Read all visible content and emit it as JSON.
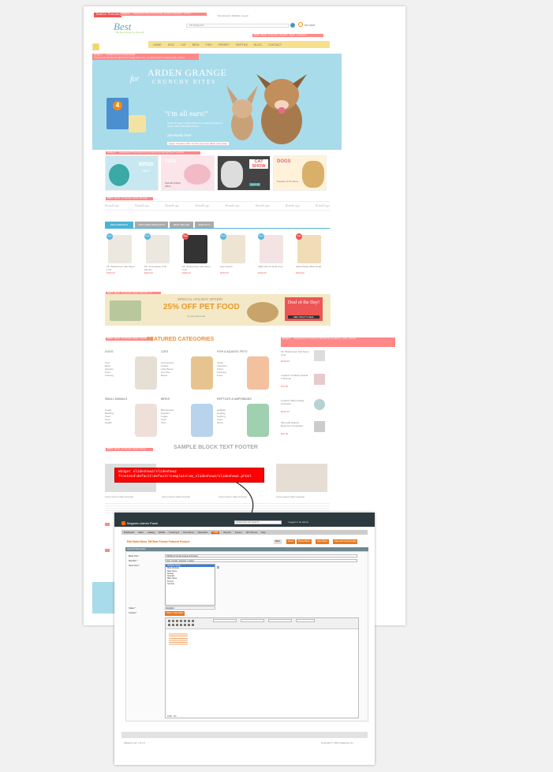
{
  "store": {
    "preview_label": "Enable Preview",
    "logo": "Best",
    "tagline": "The best choice on the web",
    "search_category": "All Categories",
    "cart_label": "MY CART",
    "nav": [
      "HOME",
      "DOG",
      "CAT",
      "BIRD",
      "FISH",
      "FERRET",
      "REPTILE",
      "BLOG",
      "CONTACT"
    ],
    "hints": {
      "top": "Widget: template/cms/frontend_blocks/header.phtml",
      "nav": "BEST Best Friends Header Menu Content",
      "slide": "Widget: slideshow2/slideshow2",
      "slide2": "frontend/default/default/template/sm_slideshow2/slideshow2.phtml",
      "tiles": "Widget: template/frontend/sm_blocks/grid/default.phtml",
      "brands": "BEST Best Friends Home Brand",
      "deal": "BEST Best Friends Home Banner 2",
      "featured": "BEST Best Friends Home Featured",
      "right": "Widget: template/frontend/default/product_list.phtml",
      "footer": "BEST Best Friends Home Blog"
    },
    "banner": {
      "brand_line1": "ARDEN GRANGE",
      "brand_line2": "CRUNCHY BITES",
      "script": "for",
      "quote": "\"i'm all ears!\"",
      "body": "Arden Grange Crunchy Bites are a delicious treat for dogs, made with fresh chicken",
      "cta": "absolutely free!",
      "badge": "4"
    },
    "tiles": [
      {
        "title": "BIRDS",
        "sub": "SALE"
      },
      {
        "title": "PIGS",
        "sub": "Special holiday offers"
      },
      {
        "title": "CAT SHOW",
        "sub": "OCT 16"
      },
      {
        "title": "DOGS",
        "sub": "Supplies & Products"
      }
    ],
    "brand_word": "BrandLogo",
    "tabs": [
      "NEW ARRIVALS",
      "FEATURED PRODUCTS",
      "BEST SELLER",
      "SPECIALS"
    ],
    "products": [
      {
        "name": "18\" Widescreen Flat Panel LCD",
        "price": "$180.00",
        "badge": "New"
      },
      {
        "name": "22\" Syncmaster LCD Monitor",
        "price": "$180.00",
        "badge": "New"
      },
      {
        "name": "24\" Widescreen Flat Panel LCD",
        "price": "$180.00",
        "badge": "Sale"
      },
      {
        "name": "Acer Ferrari",
        "price": "$180.00",
        "badge": "New"
      },
      {
        "name": "AMD A64 X2 Dual Core",
        "price": "$180.00",
        "badge": "New"
      },
      {
        "name": "Akana Beds 2500 Small",
        "price": "$180.00",
        "badge": "Sale"
      }
    ],
    "deal": {
      "top": "SPECIAL HOLIDAY OFFER!",
      "main": "25% OFF PET FOOD",
      "sub": "on your first order",
      "badge": "Deal of the Day!",
      "badge_btn": "SEE TODAY'S DEAL"
    },
    "featured_title": "FEATURED CATEGORIES",
    "categories": [
      {
        "name": "DOGS",
        "items": [
          "Toys",
          "Beds",
          "Apparel",
          "Food",
          "Training"
        ]
      },
      {
        "name": "CATS",
        "items": [
          "Accessories",
          "Collars",
          "Litter Boxes",
          "Cat Toys",
          "Bowls"
        ]
      },
      {
        "name": "FISH & AQUATIC PETS",
        "items": [
          "Tanks",
          "Aquarium",
          "Filters",
          "Cleaning",
          "Food"
        ]
      },
      {
        "name": "SMALL ANIMALS",
        "items": [
          "Cages",
          "Bedding",
          "Food",
          "Toys",
          "Health"
        ]
      },
      {
        "name": "BIRDS",
        "items": [
          "Bird Houses",
          "Feeders",
          "Cages",
          "Food",
          "Toys"
        ]
      },
      {
        "name": "REPTILES & AMPHIBIANS",
        "items": [
          "Habitats",
          "Heating",
          "Lighting",
          "Food",
          "Décor"
        ]
      }
    ],
    "right_list": [
      {
        "name": "19\" Widescreen Flat Panel LCD",
        "price": "$150.00"
      },
      {
        "name": "Logitech Cordless Optical Trackman",
        "price": "$70.00"
      },
      {
        "name": "Logitech diNovo Edge Keyboard",
        "price": "$360.00"
      },
      {
        "name": "Microsoft Natural Ergonomic Keyboard",
        "price": "$40.00"
      }
    ],
    "footer_title": "SAMPLE BLOCK TEXT FOOTER",
    "footer_posts": [
      "Lorem ipsum dolor sit amet",
      "Lorem ipsum dolor sit amet",
      "Lorem ipsum dolor sit amet",
      "Lorem ipsum dolor sit amet"
    ]
  },
  "callout": {
    "line1": "Widget slideshow2/slideshow2",
    "line2": "frontend\\default\\default\\template\\sm_slideshow2/slideshow2.phtml"
  },
  "admin": {
    "logo": "Magento Admin Panel",
    "search_placeholder": "Global Record Search",
    "logged_in": "Logged in as admin",
    "menu": [
      "Dashboard",
      "Sales",
      "Catalog",
      "Mobile",
      "Customers",
      "Promotions",
      "Newsletter",
      "CMS",
      "Reports",
      "System",
      "SM Themes",
      "Help"
    ],
    "active_menu": "CMS",
    "page_title": "Edit Static Block 'SM Best Friends Featured Product'",
    "buttons": [
      "Back",
      "Reset",
      "Delete Block",
      "Save Block",
      "Save and Continue Edit"
    ],
    "section": "General Information",
    "fields": {
      "title_label": "Block Title *",
      "title_value": "SM Best Friends Featured Product",
      "identifier_label": "Identifier *",
      "identifier_value": "best_friends_featured_product",
      "store_label": "Store View *",
      "status_label": "Status *",
      "status_value": "Enabled",
      "content_label": "Content *",
      "editor_button": "Show / Hide Editor"
    },
    "store_options": [
      "All Store Views",
      "Main Website",
      "Main Store",
      "Default",
      "Spanish",
      "Main Store",
      "French",
      "German"
    ],
    "path": "Path: div",
    "footer_left": "Magento ver. 1.9.1.0",
    "footer_right": "Copyright © 2014 Magento Inc."
  }
}
